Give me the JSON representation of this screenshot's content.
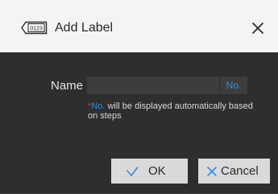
{
  "dialog": {
    "title": "Add Label",
    "icon": "label-icon",
    "icon_text": "0123",
    "close_icon": "close-icon"
  },
  "form": {
    "name_label": "Name",
    "name_value": "",
    "number_tag": "No."
  },
  "hint": {
    "marker": "*",
    "number_tag": "No.",
    "text": " will be displayed automatically based on steps"
  },
  "buttons": {
    "ok_label": "OK",
    "ok_icon": "check-icon",
    "cancel_label": "Cancel",
    "cancel_icon": "x-icon"
  },
  "colors": {
    "accent": "#2f8ee6",
    "required_marker": "#e23c3c",
    "body_bg": "#2e2e2e",
    "title_bg": "#f4f4f4",
    "button_bg": "#dadada"
  }
}
